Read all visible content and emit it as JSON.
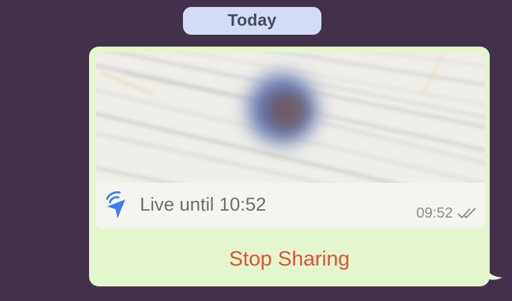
{
  "date_separator": {
    "label": "Today"
  },
  "live_location": {
    "status_text": "Live until 10:52",
    "timestamp": "09:52",
    "read_receipt_icon": "double-check-icon",
    "live_icon": "live-location-arrow-icon"
  },
  "actions": {
    "stop_label": "Stop Sharing"
  },
  "colors": {
    "background": "#43304a",
    "bubble": "#e3f6cd",
    "date_pill": "#d3dcf6",
    "stop_text": "#dd5239",
    "live_icon": "#3d7ef5"
  }
}
